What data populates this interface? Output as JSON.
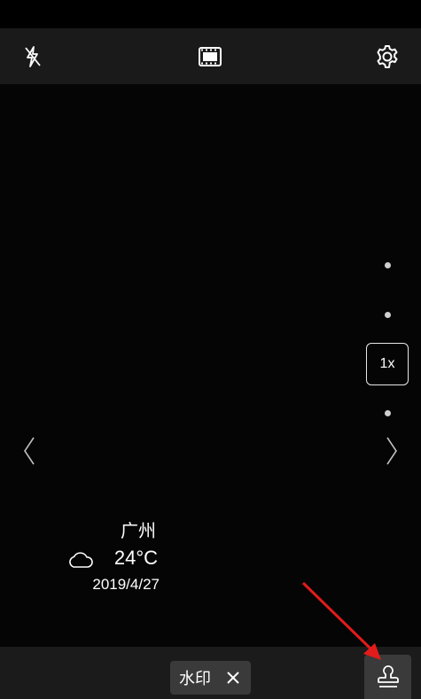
{
  "top_bar": {
    "icons": [
      "flash-off-icon",
      "video-mode-icon",
      "settings-gear-icon"
    ]
  },
  "zoom": {
    "label": "1x"
  },
  "navigation": {
    "prev_icon": "chevron-left-icon",
    "next_icon": "chevron-right-icon"
  },
  "watermark_overlay": {
    "city": "广州",
    "weather_icon": "cloud-icon",
    "temperature": "24°C",
    "date": "2019/4/27"
  },
  "bottom_bar": {
    "watermark_chip_label": "水印",
    "chip_close_icon": "close-icon",
    "stamp_icon": "stamp-icon"
  },
  "annotation": {
    "arrow_color": "#e21b1b"
  }
}
